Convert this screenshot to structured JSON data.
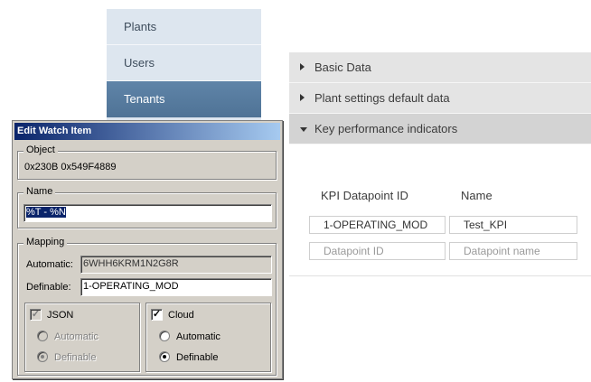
{
  "nav": {
    "items": [
      {
        "label": "Plants"
      },
      {
        "label": "Users"
      },
      {
        "label": "Tenants"
      }
    ]
  },
  "accordion": {
    "sections": [
      {
        "label": "Basic Data",
        "expanded": false
      },
      {
        "label": "Plant settings default data",
        "expanded": false
      },
      {
        "label": "Key performance indicators",
        "expanded": true
      }
    ],
    "kpi": {
      "col_datapoint": "KPI Datapoint ID",
      "col_name": "Name",
      "row": {
        "datapoint": "1-OPERATING_MOD",
        "name": "Test_KPI"
      },
      "new_row": {
        "datapoint_placeholder": "Datapoint ID",
        "name_placeholder": "Datapoint name"
      }
    }
  },
  "dialog": {
    "title": "Edit Watch Item",
    "object": {
      "label": "Object",
      "value": "0x230B 0x549F4889"
    },
    "name": {
      "label": "Name",
      "value": "%T - %N"
    },
    "mapping": {
      "label": "Mapping",
      "automatic_label": "Automatic:",
      "automatic_value": "6WHH6KRM1N2G8R",
      "definable_label": "Definable:",
      "definable_value": "1-OPERATING_MOD"
    },
    "json": {
      "label": "JSON",
      "checked": true,
      "enabled": false,
      "opt_automatic": "Automatic",
      "opt_definable": "Definable",
      "selected": "Definable"
    },
    "cloud": {
      "label": "Cloud",
      "checked": true,
      "enabled": true,
      "opt_automatic": "Automatic",
      "opt_definable": "Definable",
      "selected": "Definable"
    }
  },
  "colors": {
    "nav_bg": "#dde6ef",
    "nav_active": "#5a7fa3",
    "accordion_header": "#e4e4e4",
    "dialog_face": "#d4d0c8",
    "titlebar_start": "#0a246a",
    "titlebar_end": "#a6caf0"
  },
  "icons": [
    "caret-right-icon",
    "caret-down-icon",
    "checkbox-checked-icon",
    "radio-selected-icon"
  ]
}
